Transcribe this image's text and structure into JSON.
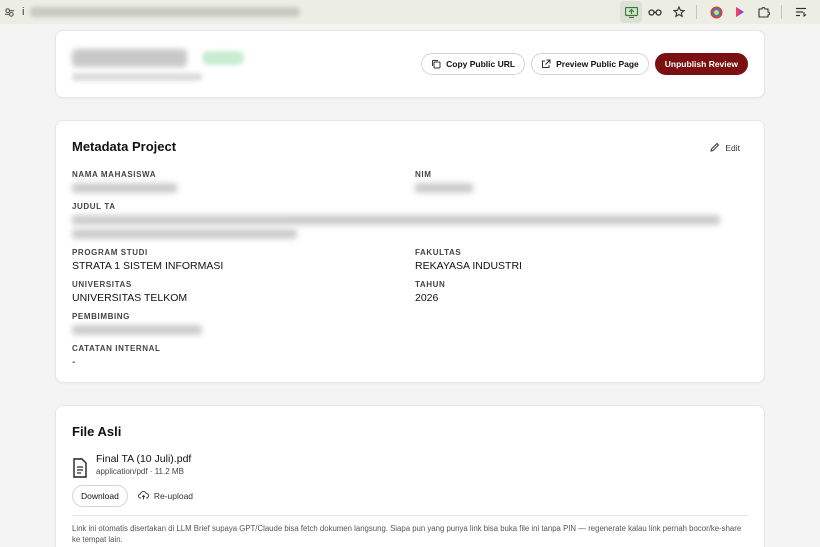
{
  "browser": {
    "url_text": "i",
    "icons": [
      "site-settings-icon",
      "screen-share-icon",
      "password-key-icon",
      "bookmark-star-icon",
      "chrome-profile-icon",
      "extension-color-icon",
      "extensions-puzzle-icon",
      "reading-list-icon"
    ]
  },
  "header": {
    "actions": {
      "copy_url": "Copy Public URL",
      "preview": "Preview Public Page",
      "unpublish": "Unpublish Review"
    }
  },
  "metadata": {
    "title": "Metadata Project",
    "edit_label": "Edit",
    "fields": {
      "nama_label": "NAMA MAHASISWA",
      "nim_label": "NIM",
      "judul_label": "JUDUL TA",
      "prodi_label": "PROGRAM STUDI",
      "prodi_value": "Strata 1 Sistem Informasi",
      "fakultas_label": "FAKULTAS",
      "fakultas_value": "Rekayasa Industri",
      "univ_label": "UNIVERSITAS",
      "univ_value": "Universitas Telkom",
      "tahun_label": "TAHUN",
      "tahun_value": "2026",
      "pembimbing_label": "PEMBIMBING",
      "catatan_label": "CATATAN INTERNAL",
      "catatan_value": "-"
    }
  },
  "file": {
    "title": "File Asli",
    "name": "Final TA (10 Juli).pdf",
    "meta": "application/pdf · 11.2 MB",
    "download_label": "Download",
    "reupload_label": "Re-upload",
    "note": "Link ini otomatis disertakan di LLM Brief supaya GPT/Claude bisa fetch dokumen langsung. Siapa pun yang punya link bisa buka file ini tanpa PIN — regenerate kalau link pernah bocor/ke-share ke tempat lain."
  },
  "colors": {
    "danger": "#7a1012",
    "status_badge": "#c9ecd2"
  }
}
